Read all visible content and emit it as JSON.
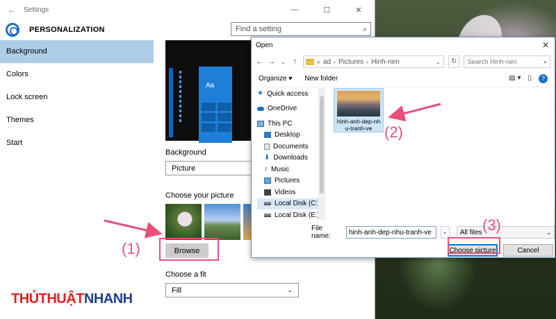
{
  "settings": {
    "window_title": "Settings",
    "back_icon": "←",
    "minimize": "—",
    "maximize": "☐",
    "close": "✕",
    "header_title": "PERSONALIZATION",
    "search_placeholder": "Find a setting",
    "search_icon": "⌕",
    "sidebar": [
      {
        "label": "Background"
      },
      {
        "label": "Colors"
      },
      {
        "label": "Lock screen"
      },
      {
        "label": "Themes"
      },
      {
        "label": "Start"
      }
    ],
    "preview_tile_text": "Aa",
    "background_label": "Background",
    "background_value": "Picture",
    "choose_picture_label": "Choose your picture",
    "browse_label": "Browse",
    "choose_fit_label": "Choose a fit",
    "fit_value": "Fill",
    "chevron": "⌄"
  },
  "dialog": {
    "title": "Open",
    "close": "✕",
    "nav_back": "←",
    "nav_forward": "→",
    "nav_down": "⌄",
    "nav_up": "↑",
    "address": {
      "prefix": "«",
      "parts": [
        "ad",
        "Pictures",
        "Hinh-nen"
      ],
      "sep": "›",
      "chevron": "⌄"
    },
    "refresh": "↻",
    "search_placeholder": "Search Hinh-nen",
    "search_icon": "⌕",
    "organize_label": "Organize ▾",
    "new_folder_label": "New folder",
    "view_icon": "▤ ▾",
    "pane_icon": "▯",
    "help_icon": "?",
    "nav_items": [
      {
        "label": "Quick access"
      },
      {
        "label": "OneDrive"
      },
      {
        "label": "This PC"
      },
      {
        "label": "Desktop"
      },
      {
        "label": "Documents"
      },
      {
        "label": "Downloads"
      },
      {
        "label": "Music"
      },
      {
        "label": "Pictures"
      },
      {
        "label": "Videos"
      },
      {
        "label": "Local Disk (C:)"
      },
      {
        "label": "Local Disk (E:)"
      }
    ],
    "nav_symbols": {
      "star": "★",
      "down": "⬇",
      "music": "♪"
    },
    "file": {
      "name_line1": "hinh-anh-dep-nh",
      "name_line2": "u-tranh-ve"
    },
    "file_name_label": "File name:",
    "file_name_value": "hinh-anh-dep-nhu-tranh-ve",
    "file_name_chevron": "⌄",
    "file_type_value": "All files",
    "choose_button": "Choose picture",
    "cancel_button": "Cancel"
  },
  "annotations": {
    "step1": "(1)",
    "step2": "(2)",
    "step3": "(3)",
    "accent_color": "#e8507a"
  },
  "watermark": {
    "part1": "THỦTHUẬT",
    "part2": "NHANH"
  }
}
